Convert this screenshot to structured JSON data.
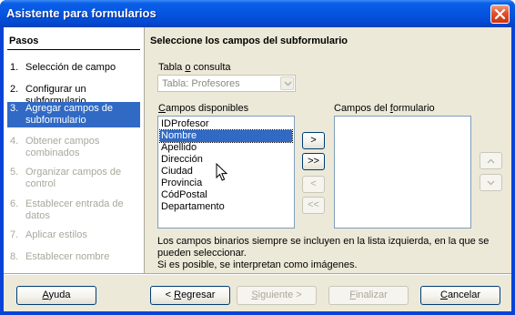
{
  "window": {
    "title": "Asistente para formularios"
  },
  "steps": {
    "header": "Pasos",
    "items": [
      {
        "num": "1.",
        "label": "Selección de campo",
        "state": "normal"
      },
      {
        "num": "2.",
        "label": "Configurar un subformulario",
        "state": "normal"
      },
      {
        "num": "3.",
        "label": "Agregar campos de subformulario",
        "state": "active"
      },
      {
        "num": "4.",
        "label": "Obtener campos combinados",
        "state": "disabled"
      },
      {
        "num": "5.",
        "label": "Organizar campos de control",
        "state": "disabled"
      },
      {
        "num": "6.",
        "label": "Establecer entrada de datos",
        "state": "disabled"
      },
      {
        "num": "7.",
        "label": "Aplicar estilos",
        "state": "disabled"
      },
      {
        "num": "8.",
        "label": "Establecer nombre",
        "state": "disabled"
      }
    ]
  },
  "main": {
    "title": "Seleccione los campos del subformulario",
    "table_label_pre": "Tabla ",
    "table_label_u": "o",
    "table_label_post": " consulta",
    "table_value": "Tabla: Profesores",
    "available_label_u": "C",
    "available_label_post": "ampos disponibles",
    "available_fields": [
      "IDProfesor",
      "Nombre",
      "Apellido",
      "Dirección",
      "Ciudad",
      "Provincia",
      "CódPostal",
      "Departamento"
    ],
    "selected_field": "Nombre",
    "form_fields_label_pre": "Campos del ",
    "form_fields_label_u": "f",
    "form_fields_label_post": "ormulario",
    "move_buttons": {
      "add_one": ">",
      "add_all": ">>",
      "remove_one": "<",
      "remove_all": "<<"
    },
    "order_buttons": {
      "up": "^",
      "down": "v"
    },
    "note_line1": "Los campos binarios siempre se incluyen en la lista izquierda, en la que se pueden seleccionar.",
    "note_line2": "Si es posible, se interpretan como imágenes."
  },
  "footer": {
    "help_u": "A",
    "help_post": "yuda",
    "back_pre": "< ",
    "back_u": "R",
    "back_post": "egresar",
    "next_u": "S",
    "next_post": "iguiente >",
    "finish_u": "F",
    "finish_post": "inalizar",
    "cancel_u": "C",
    "cancel_post": "ancelar"
  },
  "colors": {
    "selection": "#316ac5",
    "titlebar": "#0555e0",
    "dialog_bg": "#ece9d8",
    "disabled_text": "#a8a89c"
  }
}
